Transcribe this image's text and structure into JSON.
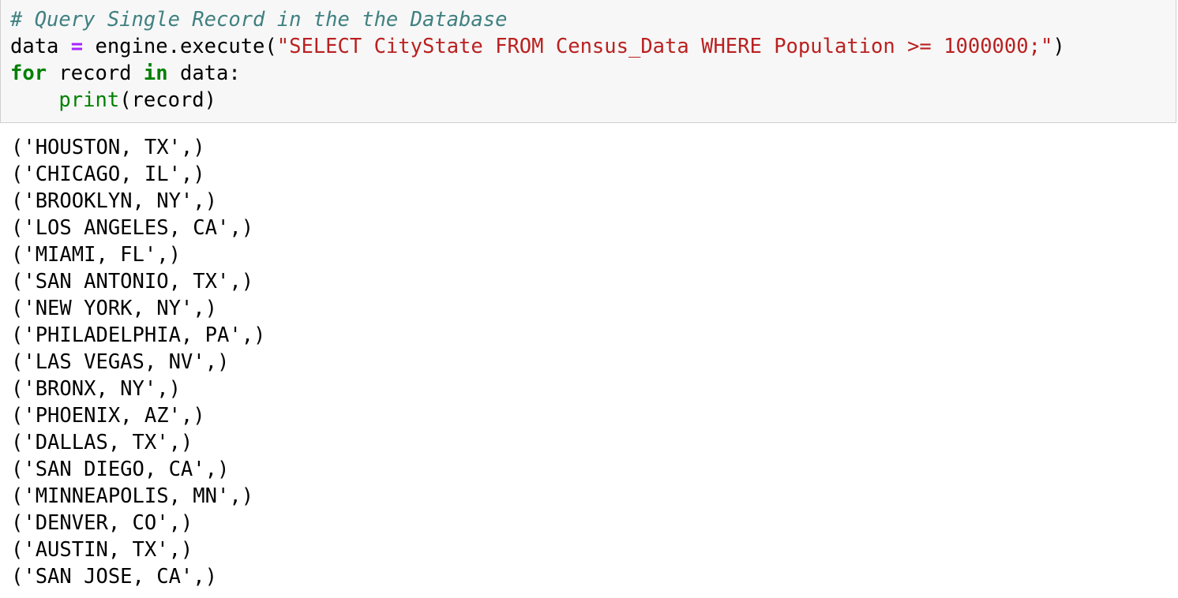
{
  "cell": {
    "comment": "# Query Single Record in the the Database",
    "line2": {
      "var": "data ",
      "op": "=",
      "call": " engine.execute(",
      "string": "\"SELECT CityState FROM Census_Data WHERE Population >= 1000000;\"",
      "close": ")"
    },
    "line3": {
      "kw_for": "for",
      "mid1": " record ",
      "kw_in": "in",
      "mid2": " data:"
    },
    "line4": {
      "indent": "    ",
      "func": "print",
      "args": "(record)"
    }
  },
  "output": [
    "('HOUSTON, TX',)",
    "('CHICAGO, IL',)",
    "('BROOKLYN, NY',)",
    "('LOS ANGELES, CA',)",
    "('MIAMI, FL',)",
    "('SAN ANTONIO, TX',)",
    "('NEW YORK, NY',)",
    "('PHILADELPHIA, PA',)",
    "('LAS VEGAS, NV',)",
    "('BRONX, NY',)",
    "('PHOENIX, AZ',)",
    "('DALLAS, TX',)",
    "('SAN DIEGO, CA',)",
    "('MINNEAPOLIS, MN',)",
    "('DENVER, CO',)",
    "('AUSTIN, TX',)",
    "('SAN JOSE, CA',)"
  ],
  "colors": {
    "comment": "#408080",
    "keyword": "#008000",
    "operator": "#aa22ff",
    "string": "#ba2121",
    "cell_background": "#f7f7f7"
  }
}
